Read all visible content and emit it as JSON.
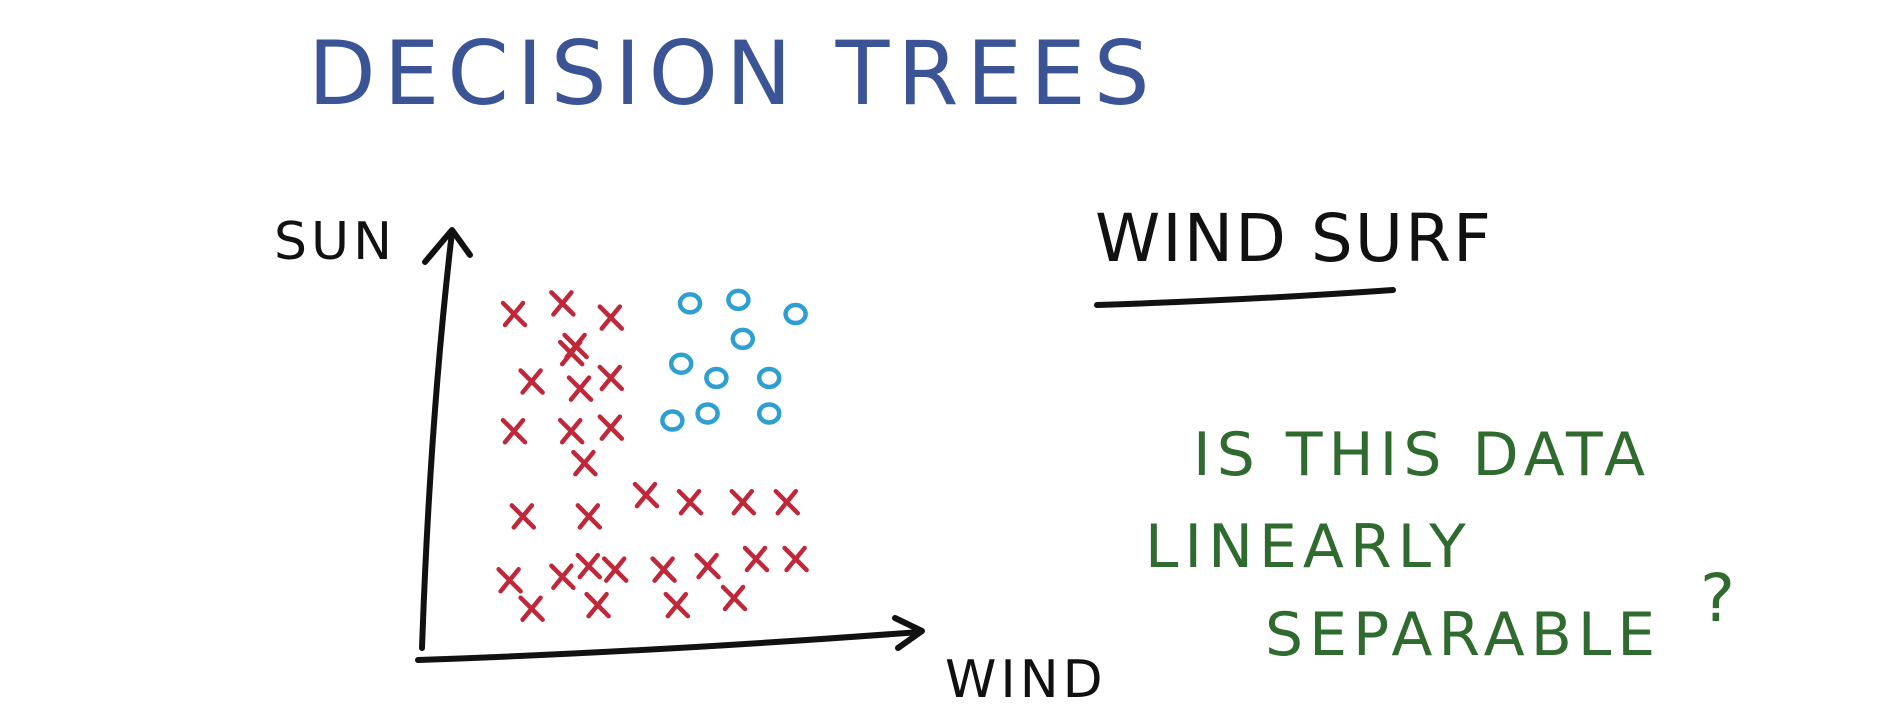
{
  "title": "DECISION TREES",
  "side_title": "WIND SURF",
  "question": {
    "line1": "IS THIS DATA",
    "line2": "LINEARLY",
    "line3": "SEPARABLE",
    "mark": "?"
  },
  "colors": {
    "title": "#3b5495",
    "negative": "#c0283a",
    "positive": "#2e9fcf",
    "question": "#2f6b2f",
    "ink": "#111111"
  },
  "chart_data": {
    "type": "scatter",
    "xlabel": "WIND",
    "ylabel": "SUN",
    "grid": false,
    "series": [
      {
        "marker": "x",
        "color": "#c0283a",
        "points": [
          [
            0.1,
            0.89
          ],
          [
            0.21,
            0.92
          ],
          [
            0.32,
            0.88
          ],
          [
            0.23,
            0.78
          ],
          [
            0.24,
            0.8
          ],
          [
            0.14,
            0.7
          ],
          [
            0.25,
            0.68
          ],
          [
            0.32,
            0.71
          ],
          [
            0.1,
            0.56
          ],
          [
            0.23,
            0.56
          ],
          [
            0.32,
            0.57
          ],
          [
            0.26,
            0.47
          ],
          [
            0.12,
            0.32
          ],
          [
            0.27,
            0.32
          ],
          [
            0.4,
            0.38
          ],
          [
            0.5,
            0.36
          ],
          [
            0.62,
            0.36
          ],
          [
            0.72,
            0.36
          ],
          [
            0.09,
            0.14
          ],
          [
            0.21,
            0.15
          ],
          [
            0.27,
            0.18
          ],
          [
            0.33,
            0.17
          ],
          [
            0.44,
            0.17
          ],
          [
            0.54,
            0.18
          ],
          [
            0.65,
            0.2
          ],
          [
            0.74,
            0.2
          ],
          [
            0.14,
            0.06
          ],
          [
            0.29,
            0.07
          ],
          [
            0.47,
            0.07
          ],
          [
            0.6,
            0.09
          ]
        ]
      },
      {
        "marker": "o",
        "color": "#2e9fcf",
        "points": [
          [
            0.5,
            0.92
          ],
          [
            0.61,
            0.93
          ],
          [
            0.74,
            0.89
          ],
          [
            0.62,
            0.82
          ],
          [
            0.48,
            0.75
          ],
          [
            0.56,
            0.71
          ],
          [
            0.68,
            0.71
          ],
          [
            0.68,
            0.61
          ],
          [
            0.46,
            0.59
          ],
          [
            0.54,
            0.61
          ]
        ]
      }
    ]
  }
}
